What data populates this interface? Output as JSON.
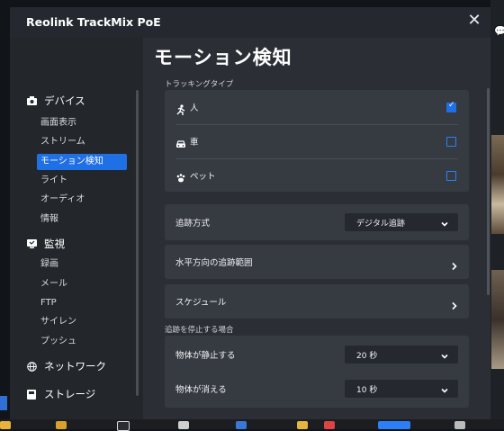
{
  "dialog": {
    "title": "Reolink TrackMix PoE",
    "close_glyph": "✕"
  },
  "sidebar": {
    "categories": [
      {
        "label": "デバイス",
        "icon": "camera-icon"
      },
      {
        "label": "監視",
        "icon": "monitor-icon"
      },
      {
        "label": "ネットワーク",
        "icon": "globe-icon"
      },
      {
        "label": "ストレージ",
        "icon": "storage-icon"
      }
    ],
    "device_items": [
      "画面表示",
      "ストリーム",
      "モーション検知",
      "ライト",
      "オーディオ",
      "情報"
    ],
    "monitor_items": [
      "録画",
      "メール",
      "FTP",
      "サイレン",
      "プッシュ"
    ],
    "active_item": "モーション検知"
  },
  "main": {
    "title": "モーション検知",
    "tracking_type_label": "トラッキングタイプ",
    "targets": [
      {
        "label": "人",
        "checked": true,
        "icon": "person-icon"
      },
      {
        "label": "車",
        "checked": false,
        "icon": "car-icon"
      },
      {
        "label": "ペット",
        "checked": false,
        "icon": "paw-icon"
      }
    ],
    "tracking_method": {
      "label": "追跡方式",
      "value": "デジタル追跡"
    },
    "horizontal_range": {
      "label": "水平方向の追跡範囲"
    },
    "schedule": {
      "label": "スケジュール"
    },
    "stop_section_label": "追跡を停止する場合",
    "stop_conditions": [
      {
        "label": "物体が静止する",
        "value": "20 秒"
      },
      {
        "label": "物体が消える",
        "value": "10 秒"
      }
    ]
  },
  "colors": {
    "accent": "#1f6fe5",
    "panel": "#2b2f35",
    "card": "#363b42"
  }
}
